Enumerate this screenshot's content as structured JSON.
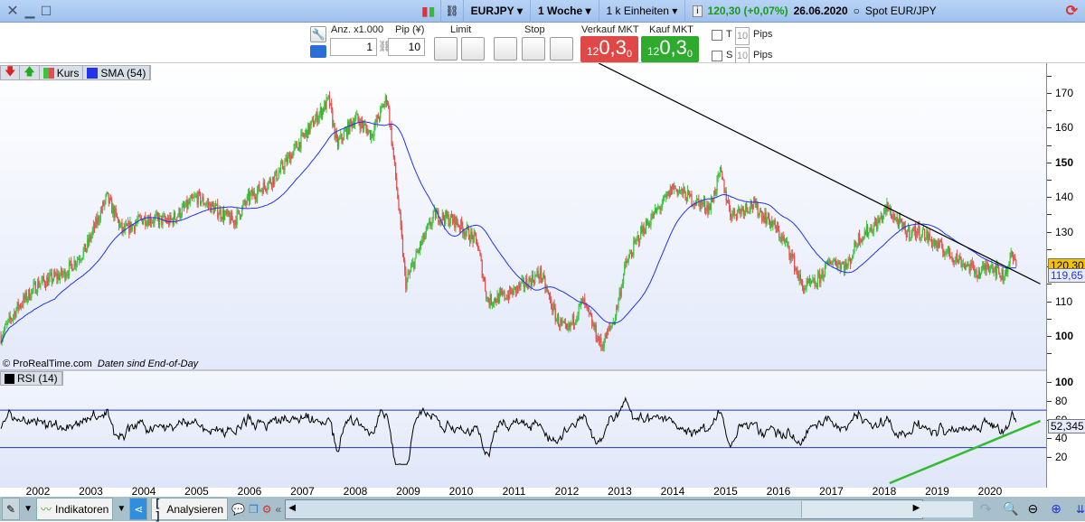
{
  "titlebar": {
    "symbol": "EURJPY",
    "period": "1 Woche",
    "units": "1 k Einheiten",
    "price": "120,30 (+0,07%)",
    "date": "26.06.2020",
    "spot": "Spot EUR/JPY"
  },
  "toolbar": {
    "qty_label": "Anz. x1.000",
    "qty_value": "1",
    "pip_label": "Pip (¥)",
    "pip_value": "10",
    "limit_label": "Limit",
    "stop_label": "Stop",
    "sell_label": "Verkauf MKT",
    "buy_label": "Kauf MKT",
    "sell_small": "12",
    "sell_big": "0,3",
    "sell_sup": "0",
    "buy_small": "12",
    "buy_big": "0,3",
    "buy_sup": "0",
    "t_label": "T",
    "s_label": "S",
    "t_pips": "10",
    "s_pips": "10",
    "pips_label": "Pips"
  },
  "legend": {
    "kurs": "Kurs",
    "sma": "SMA (54)",
    "rsi": "RSI (14)"
  },
  "watermark": "© ProRealTime.com",
  "eod_note": "Daten sind End-of-Day",
  "bottombar": {
    "indicators": "Indikatoren",
    "analyze": "Analysieren"
  },
  "colors": {
    "up": "#3cc43c",
    "down": "#e05050",
    "sma": "#2233ee",
    "trend_rsi": "#33bb33"
  },
  "chart_data": [
    {
      "type": "candlestick",
      "title": "EURJPY 1 Woche",
      "x_ticks": [
        "2002",
        "2003",
        "2004",
        "2005",
        "2006",
        "2007",
        "2008",
        "2009",
        "2010",
        "2011",
        "2012",
        "2013",
        "2014",
        "2015",
        "2016",
        "2017",
        "2018",
        "2019",
        "2020"
      ],
      "y_ticks": [
        "170",
        "160",
        "150",
        "140",
        "130",
        "120",
        "110",
        "100"
      ],
      "ylim": [
        92,
        178
      ],
      "xlim": [
        2001.3,
        2020.95
      ],
      "last_price": "120,30",
      "sma_value": "119,65",
      "sma_period": 54,
      "price_path": [
        [
          2001.3,
          100
        ],
        [
          2001.6,
          108
        ],
        [
          2002.0,
          115
        ],
        [
          2002.5,
          118
        ],
        [
          2002.9,
          125
        ],
        [
          2003.3,
          140
        ],
        [
          2003.6,
          130
        ],
        [
          2004.0,
          134
        ],
        [
          2004.5,
          133
        ],
        [
          2005.0,
          140
        ],
        [
          2005.3,
          137
        ],
        [
          2005.7,
          133
        ],
        [
          2006.0,
          140
        ],
        [
          2006.5,
          146
        ],
        [
          2007.0,
          157
        ],
        [
          2007.5,
          168
        ],
        [
          2007.65,
          155
        ],
        [
          2008.0,
          163
        ],
        [
          2008.3,
          158
        ],
        [
          2008.6,
          169
        ],
        [
          2008.8,
          140
        ],
        [
          2008.95,
          115
        ],
        [
          2009.2,
          125
        ],
        [
          2009.5,
          135
        ],
        [
          2009.9,
          133
        ],
        [
          2010.3,
          127
        ],
        [
          2010.5,
          110
        ],
        [
          2010.9,
          112
        ],
        [
          2011.2,
          115
        ],
        [
          2011.5,
          118
        ],
        [
          2011.8,
          105
        ],
        [
          2012.0,
          101
        ],
        [
          2012.3,
          110
        ],
        [
          2012.65,
          97
        ],
        [
          2012.9,
          105
        ],
        [
          2013.1,
          120
        ],
        [
          2013.4,
          130
        ],
        [
          2013.9,
          140
        ],
        [
          2014.0,
          143
        ],
        [
          2014.4,
          139
        ],
        [
          2014.7,
          137
        ],
        [
          2014.9,
          147
        ],
        [
          2015.1,
          135
        ],
        [
          2015.5,
          138
        ],
        [
          2015.9,
          132
        ],
        [
          2016.2,
          125
        ],
        [
          2016.45,
          114
        ],
        [
          2016.7,
          115
        ],
        [
          2017.0,
          122
        ],
        [
          2017.3,
          120
        ],
        [
          2017.5,
          128
        ],
        [
          2017.9,
          133
        ],
        [
          2018.05,
          137
        ],
        [
          2018.4,
          130
        ],
        [
          2018.7,
          130
        ],
        [
          2019.0,
          126
        ],
        [
          2019.5,
          121
        ],
        [
          2019.8,
          118
        ],
        [
          2020.0,
          121
        ],
        [
          2020.25,
          117
        ],
        [
          2020.4,
          123
        ],
        [
          2020.5,
          120.3
        ]
      ],
      "trendline": [
        [
          2012.6,
          178.6
        ],
        [
          2020.95,
          115
        ]
      ]
    },
    {
      "type": "line",
      "title": "RSI (14)",
      "y_ticks": [
        "100",
        "80",
        "60",
        "40",
        "20"
      ],
      "ylim": [
        10,
        105
      ],
      "levels": [
        70,
        30
      ],
      "last_value": "52,345",
      "trendline": [
        [
          2018.1,
          -8
        ],
        [
          2020.95,
          58.5
        ]
      ]
    }
  ]
}
